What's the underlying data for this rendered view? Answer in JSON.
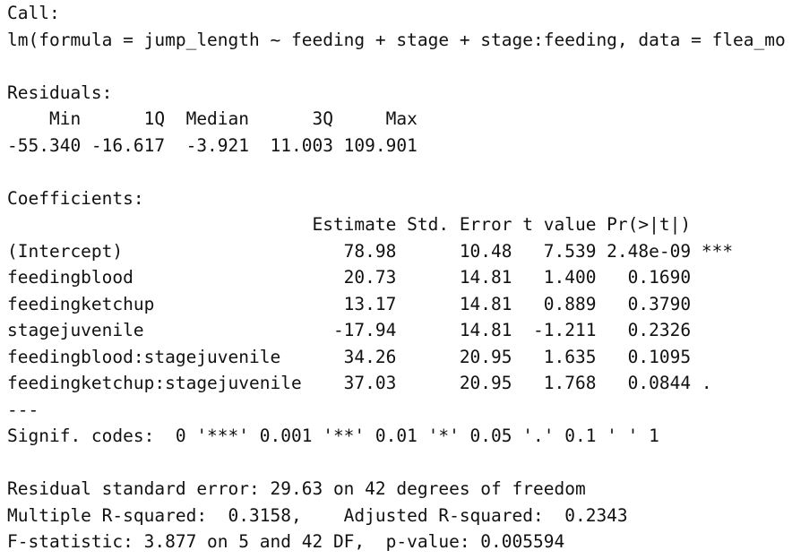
{
  "console": {
    "call_header": "Call:",
    "call_formula": "lm(formula = jump_length ~ feeding + stage + stage:feeding, data = flea_mo",
    "residuals_header": "Residuals:",
    "residuals_labels": "    Min      1Q  Median      3Q     Max ",
    "residuals_values": "-55.340 -16.617  -3.921  11.003 109.901 ",
    "coefficients_header": "Coefficients:",
    "coef_col_header": "                             Estimate Std. Error t value Pr(>|t|)    ",
    "coef_rows": [
      "(Intercept)                     78.98      10.48   7.539 2.48e-09 ***",
      "feedingblood                    20.73      14.81   1.400   0.1690    ",
      "feedingketchup                  13.17      14.81   0.889   0.3790    ",
      "stagejuvenile                  -17.94      14.81  -1.211   0.2326    ",
      "feedingblood:stagejuvenile      34.26      20.95   1.635   0.1095    ",
      "feedingketchup:stagejuvenile    37.03      20.95   1.768   0.0844 .  "
    ],
    "separator": "---",
    "signif_codes": "Signif. codes:  0 '***' 0.001 '**' 0.01 '*' 0.05 '.' 0.1 ' ' 1",
    "residual_se": "Residual standard error: 29.63 on 42 degrees of freedom",
    "r_squared": "Multiple R-squared:  0.3158,    Adjusted R-squared:  0.2343 ",
    "f_statistic": "F-statistic: 3.877 on 5 and 42 DF,  p-value: 0.005594"
  }
}
